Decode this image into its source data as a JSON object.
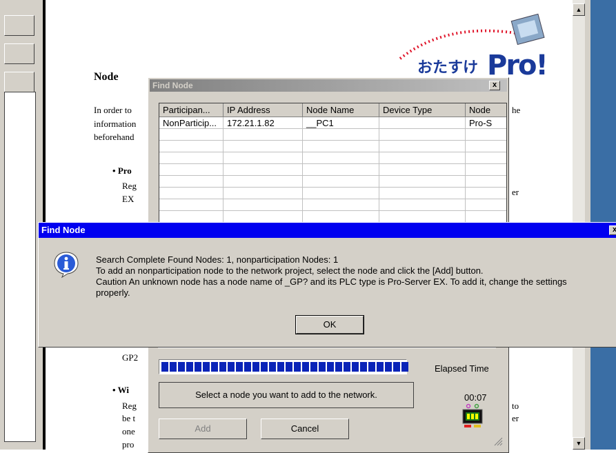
{
  "help_page": {
    "heading": "Node",
    "intro": [
      "In order to",
      "information",
      "beforehand"
    ],
    "intro_right": "he",
    "bullet1_title": "Pro",
    "bullet1_lines": [
      "Reg",
      "EX"
    ],
    "bullet1_right": "er",
    "after_lines": [
      "GP2"
    ],
    "bullet2_title": "Wi",
    "bullet2_lines": [
      "Reg",
      "be t",
      "one",
      "pro"
    ],
    "bullet2_right": [
      "to",
      "er"
    ],
    "logo_text": "おたすけ",
    "logo_pro": "Pro!"
  },
  "find_node_window": {
    "title": "Find Node",
    "columns": [
      "Participan...",
      "IP Address",
      "Node Name",
      "Device Type",
      "Node"
    ],
    "rows": [
      [
        "NonParticip...",
        "172.21.1.82",
        "__PC1",
        "",
        "Pro-S"
      ]
    ],
    "elapsed_label": "Elapsed Time",
    "elapsed_value": "00:07",
    "status_message": "Select a node you want to add to the network.",
    "add_button": "Add",
    "cancel_button": "Cancel",
    "progress_blocks": 30
  },
  "message_box": {
    "title": "Find Node",
    "lines": [
      "Search Complete Found Nodes: 1, nonparticipation Nodes: 1",
      "To add an nonparticipation node to the network project, select the node and click the [Add] button.",
      "Caution An unknown node has a node name of _GP? and its PLC type is Pro-Server EX. To add it, change the settings",
      "properly."
    ],
    "ok_button": "OK",
    "close_glyph": "x"
  },
  "icons": {
    "info": "info-icon",
    "timer": "timer-icon",
    "scroll_up": "▲",
    "scroll_down": "▼",
    "close": "x"
  },
  "colors": {
    "titlebar_active": "#0000f0",
    "titlebar_inactive": "#808080",
    "progress": "#0a24b8",
    "desktop": "#3a6ea5",
    "face": "#d4d0c8"
  }
}
